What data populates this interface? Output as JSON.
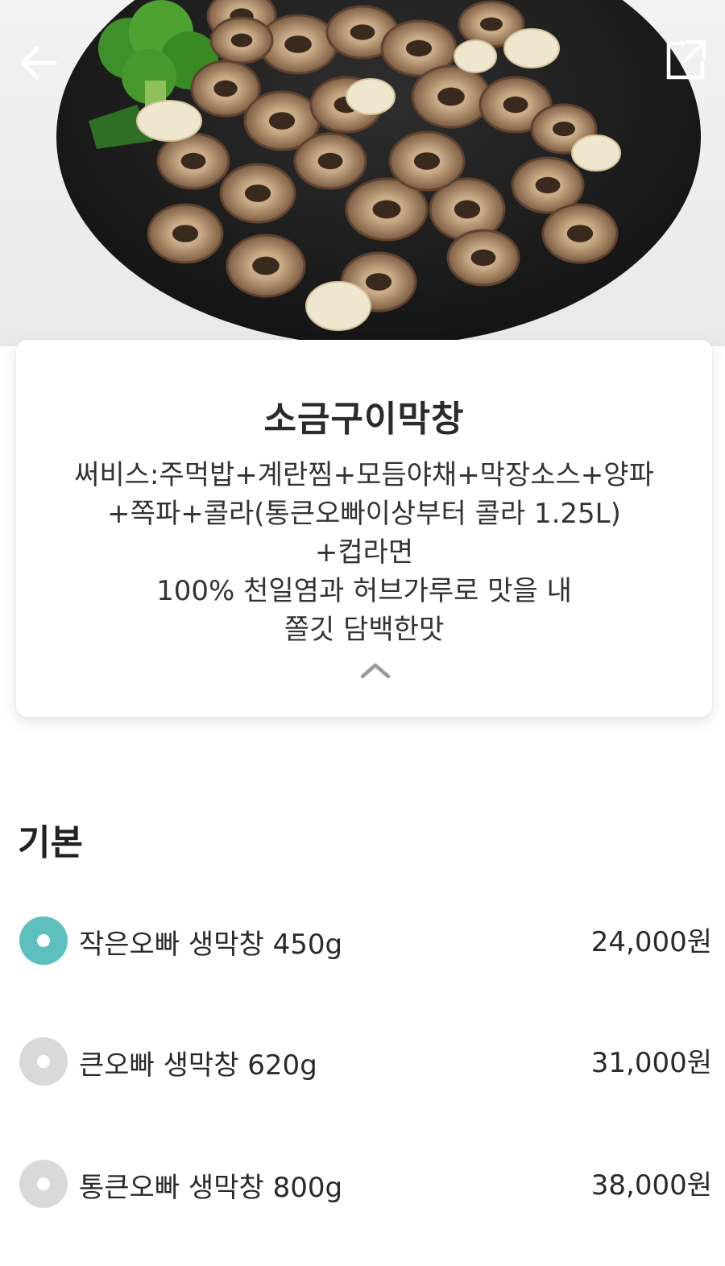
{
  "header": {
    "back_icon": "arrow-left-icon",
    "share_icon": "external-link-icon"
  },
  "product": {
    "name": "소금구이막창",
    "description_lines": [
      "써비스:주먹밥+계란찜+모듬야채+막장소스+양파",
      "+쪽파+콜라(통큰오빠이상부터 콜라 1.25L)",
      "+컵라면",
      "100% 천일염과 허브가루로 맛을 내",
      "쫄깃 담백한맛"
    ],
    "collapse_icon": "chevron-up-icon"
  },
  "options": {
    "section_title": "기본",
    "items": [
      {
        "label": "작은오빠 생막창 450g",
        "price": "24,000원",
        "selected": true
      },
      {
        "label": "큰오빠 생막창 620g",
        "price": "31,000원",
        "selected": false
      },
      {
        "label": "통큰오빠 생막창 800g",
        "price": "38,000원",
        "selected": false
      }
    ]
  },
  "colors": {
    "accent": "#5dbfbe",
    "radio_off": "#d9d9d9",
    "plate": "#1c1c1c",
    "makchang": "#b89a7a"
  }
}
